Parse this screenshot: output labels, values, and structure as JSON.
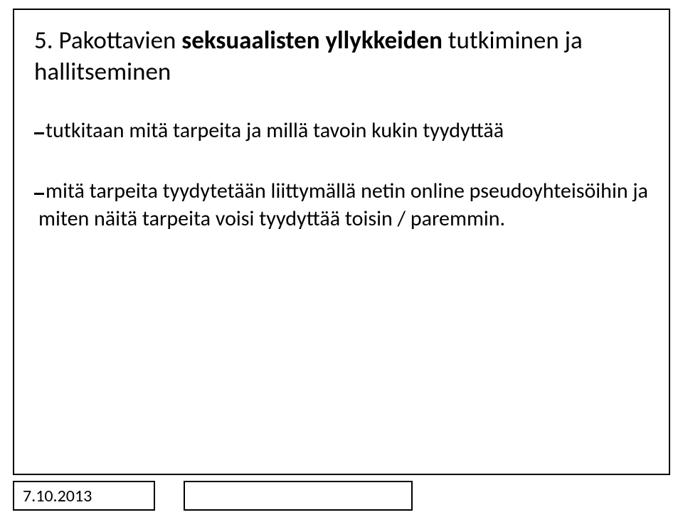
{
  "slide": {
    "title_prefix": "5. Pakottavien ",
    "title_bold": "seksuaalisten yllykkeiden",
    "title_suffix": " tutkiminen ja hallitseminen",
    "bullets": [
      "tutkitaan mitä tarpeita ja millä tavoin kukin tyydyttää",
      "mitä tarpeita tyydytetään liittymällä netin online pseudoyhteisöihin ja miten näitä tarpeita voisi tyydyttää toisin / paremmin."
    ]
  },
  "footer": {
    "date": "7.10.2013"
  }
}
